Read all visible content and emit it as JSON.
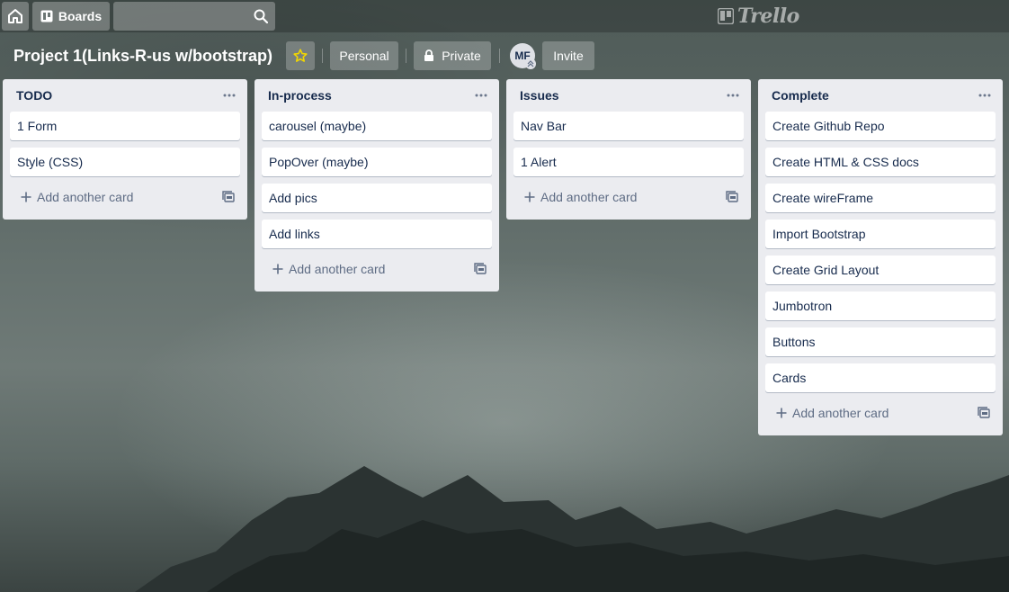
{
  "header": {
    "boards_label": "Boards",
    "search_placeholder": "",
    "logo_text": "Trello"
  },
  "board": {
    "title": "Project 1(Links-R-us w/bootstrap)",
    "visibility_team": "Personal",
    "privacy": "Private",
    "member_initials": "MF",
    "invite_label": "Invite"
  },
  "lists": [
    {
      "title": "TODO",
      "cards": [
        "1 Form",
        "Style (CSS)"
      ],
      "add_label": "Add another card"
    },
    {
      "title": "In-process",
      "cards": [
        "carousel (maybe)",
        "PopOver (maybe)",
        "Add pics",
        "Add links"
      ],
      "add_label": "Add another card"
    },
    {
      "title": "Issues",
      "cards": [
        "Nav Bar",
        "1 Alert"
      ],
      "add_label": "Add another card"
    },
    {
      "title": "Complete",
      "cards": [
        "Create Github Repo",
        "Create HTML & CSS docs",
        "Create wireFrame",
        "Import Bootstrap",
        "Create Grid Layout",
        "Jumbotron",
        "Buttons",
        "Cards"
      ],
      "add_label": "Add another card"
    }
  ],
  "colors": {
    "star": "#f2d600",
    "list_bg": "#ebecf0",
    "text": "#172b4d",
    "muted": "#5e6c84"
  },
  "icons": [
    "home-icon",
    "boards-icon",
    "search-icon",
    "trello-logo-icon",
    "star-icon",
    "lock-icon",
    "more-icon",
    "plus-icon",
    "card-template-icon"
  ]
}
